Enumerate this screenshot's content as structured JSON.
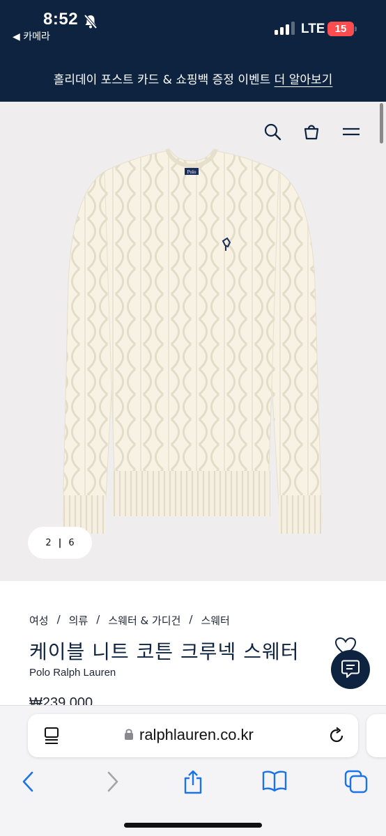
{
  "status_bar": {
    "time": "8:52",
    "back_app": "◀ 카메라",
    "network": "LTE",
    "battery": "15"
  },
  "promo": {
    "text": "홀리데이 포스트 카드 & 쇼핑백 증정 이벤트 ",
    "link": "더 알아보기"
  },
  "gallery": {
    "current": "2",
    "separator": "|",
    "total": "6",
    "logo_text": "Polo"
  },
  "product": {
    "breadcrumb": [
      "여성",
      "의류",
      "스웨터 & 가디건",
      "스웨터"
    ],
    "title": "케이블 니트 코튼 크루넥 스웨터",
    "brand": "Polo Ralph Lauren",
    "price": "₩239,000"
  },
  "browser": {
    "url": "ralphlauren.co.kr"
  },
  "icons": {
    "search": "search-icon",
    "bag": "bag-icon",
    "menu": "menu-icon",
    "heart": "heart-icon",
    "chat": "chat-icon"
  },
  "colors": {
    "navy": "#0d2340",
    "hero_bg": "#efedee",
    "sweater": "#f7f2e4",
    "battery": "#ff4d4f",
    "safari_blue": "#1a73e8"
  }
}
